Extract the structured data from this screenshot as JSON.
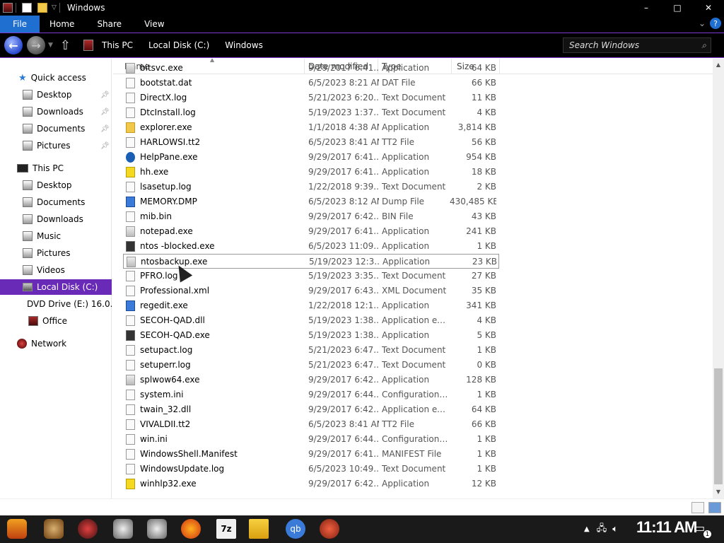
{
  "window": {
    "title": "Windows",
    "min_label": "–",
    "max_label": "□",
    "close_label": "✕"
  },
  "ribbon": {
    "tabs": [
      {
        "label": "File"
      },
      {
        "label": "Home"
      },
      {
        "label": "Share"
      },
      {
        "label": "View"
      }
    ],
    "expand_label": "⌄",
    "help_label": "?"
  },
  "address": {
    "crumbs": [
      "This PC",
      "Local Disk (C:)",
      "Windows"
    ],
    "search_placeholder": "Search Windows"
  },
  "nav": {
    "quick_access": "Quick access",
    "qa_items": [
      "Desktop",
      "Downloads",
      "Documents",
      "Pictures"
    ],
    "this_pc": "This PC",
    "pc_items": [
      "Desktop",
      "Documents",
      "Downloads",
      "Music",
      "Pictures",
      "Videos"
    ],
    "local_disk": "Local Disk (C:)",
    "dvd": "DVD Drive (E:) 16.0.",
    "office": "Office",
    "network": "Network"
  },
  "columns": {
    "name": "Name",
    "date": "Date modified",
    "type": "Type",
    "size": "Size"
  },
  "files": [
    {
      "name": "bitsvc.exe",
      "date": "9/29/2017 6:41...",
      "type": "Application",
      "size": "64 KB",
      "icon": "app"
    },
    {
      "name": "bootstat.dat",
      "date": "6/5/2023 8:21 AM",
      "type": "DAT File",
      "size": "66 KB",
      "icon": "doc"
    },
    {
      "name": "DirectX.log",
      "date": "5/21/2023 6:20...",
      "type": "Text Document",
      "size": "11 KB",
      "icon": "doc"
    },
    {
      "name": "DtcInstall.log",
      "date": "5/19/2023 1:37...",
      "type": "Text Document",
      "size": "4 KB",
      "icon": "doc"
    },
    {
      "name": "explorer.exe",
      "date": "1/1/2018 4:38 AM",
      "type": "Application",
      "size": "3,814 KB",
      "icon": "folder"
    },
    {
      "name": "HARLOWSI.tt2",
      "date": "6/5/2023 8:41 AM",
      "type": "TT2 File",
      "size": "56 KB",
      "icon": "doc"
    },
    {
      "name": "HelpPane.exe",
      "date": "9/29/2017 6:41...",
      "type": "Application",
      "size": "954 KB",
      "icon": "help"
    },
    {
      "name": "hh.exe",
      "date": "9/29/2017 6:41...",
      "type": "Application",
      "size": "18 KB",
      "icon": "yellow"
    },
    {
      "name": "lsasetup.log",
      "date": "1/22/2018 9:39...",
      "type": "Text Document",
      "size": "2 KB",
      "icon": "doc"
    },
    {
      "name": "MEMORY.DMP",
      "date": "6/5/2023 8:12 AM",
      "type": "Dump File",
      "size": "430,485 KB",
      "icon": "blue"
    },
    {
      "name": "mib.bin",
      "date": "9/29/2017 6:42...",
      "type": "BIN File",
      "size": "43 KB",
      "icon": "doc"
    },
    {
      "name": "notepad.exe",
      "date": "9/29/2017 6:41...",
      "type": "Application",
      "size": "241 KB",
      "icon": "app"
    },
    {
      "name": "ntos -blocked.exe",
      "date": "6/5/2023 11:09...",
      "type": "Application",
      "size": "1 KB",
      "icon": "dark"
    },
    {
      "name": "ntosbackup.exe",
      "date": "5/19/2023 12:3...",
      "type": "Application",
      "size": "23 KB",
      "icon": "app"
    },
    {
      "name": "PFRO.log",
      "date": "5/19/2023 3:35...",
      "type": "Text Document",
      "size": "27 KB",
      "icon": "doc"
    },
    {
      "name": "Professional.xml",
      "date": "9/29/2017 6:43...",
      "type": "XML Document",
      "size": "35 KB",
      "icon": "doc"
    },
    {
      "name": "regedit.exe",
      "date": "1/22/2018 12:1...",
      "type": "Application",
      "size": "341 KB",
      "icon": "blue"
    },
    {
      "name": "SECOH-QAD.dll",
      "date": "5/19/2023 1:38...",
      "type": "Application exte...",
      "size": "4 KB",
      "icon": "doc"
    },
    {
      "name": "SECOH-QAD.exe",
      "date": "5/19/2023 1:38...",
      "type": "Application",
      "size": "5 KB",
      "icon": "dark"
    },
    {
      "name": "setupact.log",
      "date": "5/21/2023 6:47...",
      "type": "Text Document",
      "size": "1 KB",
      "icon": "doc"
    },
    {
      "name": "setuperr.log",
      "date": "5/21/2023 6:47...",
      "type": "Text Document",
      "size": "0 KB",
      "icon": "doc"
    },
    {
      "name": "splwow64.exe",
      "date": "9/29/2017 6:42...",
      "type": "Application",
      "size": "128 KB",
      "icon": "app"
    },
    {
      "name": "system.ini",
      "date": "9/29/2017 6:44...",
      "type": "Configuration set...",
      "size": "1 KB",
      "icon": "doc"
    },
    {
      "name": "twain_32.dll",
      "date": "9/29/2017 6:42...",
      "type": "Application exte...",
      "size": "64 KB",
      "icon": "doc"
    },
    {
      "name": "VIVALDII.tt2",
      "date": "6/5/2023 8:41 AM",
      "type": "TT2 File",
      "size": "66 KB",
      "icon": "doc"
    },
    {
      "name": "win.ini",
      "date": "9/29/2017 6:44...",
      "type": "Configuration set...",
      "size": "1 KB",
      "icon": "doc"
    },
    {
      "name": "WindowsShell.Manifest",
      "date": "9/29/2017 6:41...",
      "type": "MANIFEST File",
      "size": "1 KB",
      "icon": "doc"
    },
    {
      "name": "WindowsUpdate.log",
      "date": "6/5/2023 10:49...",
      "type": "Text Document",
      "size": "1 KB",
      "icon": "doc"
    },
    {
      "name": "winhlp32.exe",
      "date": "9/29/2017 6:42...",
      "type": "Application",
      "size": "12 KB",
      "icon": "yellow"
    }
  ],
  "selected_index": 13,
  "taskbar": {
    "clock": "11:11 AM",
    "notification_count": "1",
    "apps": [
      "start",
      "app-1",
      "app-2",
      "app-3",
      "app-4",
      "firefox",
      "7-zip",
      "file-explorer",
      "qbittorrent",
      "app-5"
    ],
    "seven_zip_label": "7z",
    "qb_label": "qb"
  },
  "colors": {
    "accent": "#6a2ab8",
    "file_tab": "#1f6fd1"
  }
}
